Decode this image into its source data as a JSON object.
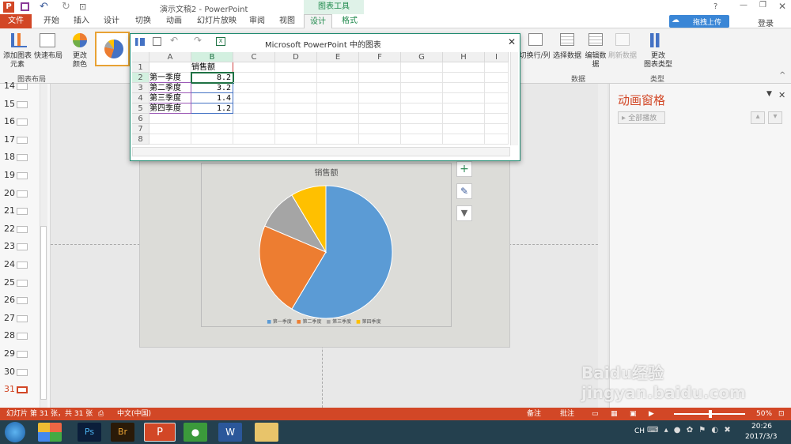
{
  "window": {
    "title": "演示文稿2 - PowerPoint",
    "help": "?",
    "upload_btn": "拖拽上传",
    "login": "登录",
    "chart_tools": "图表工具"
  },
  "tabs": [
    "文件",
    "开始",
    "插入",
    "设计",
    "切换",
    "动画",
    "幻灯片放映",
    "审阅",
    "视图",
    "设计",
    "格式"
  ],
  "ribbon": {
    "add_element": "添加图表\n元素",
    "quick_layout": "快速布局",
    "change_colors": "更改\n颜色",
    "switch_rowcol": "切换行/列",
    "select_data": "选择数据",
    "edit_data": "编辑数\n据",
    "refresh_data": "刷新数据",
    "change_type": "更改\n图表类型",
    "group_layout": "图表布局",
    "group_data": "数据",
    "group_type": "类型"
  },
  "datawin": {
    "title": "Microsoft PowerPoint 中的图表",
    "columns": [
      "A",
      "B",
      "C",
      "D",
      "E",
      "F",
      "G",
      "H",
      "I"
    ],
    "rows": [
      "1",
      "2",
      "3",
      "4",
      "5",
      "6",
      "7",
      "8"
    ],
    "header_b1": "销售额",
    "labels": [
      "第一季度",
      "第二季度",
      "第三季度",
      "第四季度"
    ],
    "values": [
      "8.2",
      "3.2",
      "1.4",
      "1.2"
    ]
  },
  "thumbs": [
    "14",
    "15",
    "16",
    "17",
    "18",
    "19",
    "20",
    "21",
    "22",
    "23",
    "24",
    "25",
    "26",
    "27",
    "28",
    "29",
    "30",
    "31"
  ],
  "chart_data": {
    "type": "pie",
    "title": "销售额",
    "categories": [
      "第一季度",
      "第二季度",
      "第三季度",
      "第四季度"
    ],
    "values": [
      8.2,
      3.2,
      1.4,
      1.2
    ],
    "colors": [
      "#5b9bd5",
      "#ed7d31",
      "#a5a5a5",
      "#ffc000"
    ]
  },
  "anim": {
    "title": "动画窗格",
    "play_all": "全部播放"
  },
  "status": {
    "slide_info": "幻灯片 第 31 张，共 31 张",
    "lang": "中文(中国)",
    "notes": "备注",
    "comments": "批注",
    "zoom": "50%"
  },
  "taskbar": {
    "ime": "CH",
    "time": "20:26",
    "date": "2017/3/3"
  },
  "watermark": "Baidu经验 jingyan.baidu.com"
}
